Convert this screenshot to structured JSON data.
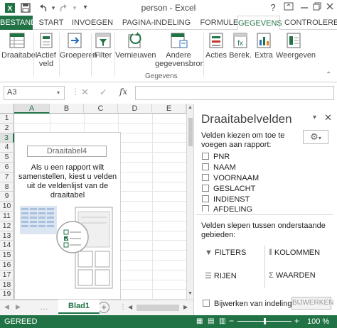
{
  "window": {
    "title": "person - Excel",
    "help_label": "?"
  },
  "tabs": [
    "BESTAND",
    "START",
    "INVOEGEN",
    "PAGINA-INDELING",
    "FORMULES",
    "GEGEVENS",
    "CONTROLERE"
  ],
  "ribbon": {
    "buttons": [
      {
        "label": "Draaitabel",
        "sub": "",
        "icon": "pivottable-icon"
      },
      {
        "label": "Actief",
        "sub": "veld",
        "icon": "active-field-icon"
      },
      {
        "label": "Groeperen",
        "sub": "",
        "icon": "group-icon"
      },
      {
        "label": "Filter",
        "sub": "",
        "icon": "filter-icon"
      },
      {
        "label": "Vernieuwen",
        "sub": "",
        "icon": "refresh-icon"
      },
      {
        "label": "Andere",
        "sub": "gegevensbron",
        "icon": "change-source-icon"
      },
      {
        "label": "Acties",
        "sub": "",
        "icon": "actions-icon"
      },
      {
        "label": "Berek.",
        "sub": "",
        "icon": "calculations-icon"
      },
      {
        "label": "Extra",
        "sub": "",
        "icon": "tools-icon"
      },
      {
        "label": "Weergeven",
        "sub": "",
        "icon": "show-icon"
      }
    ],
    "group_label": "Gegevens"
  },
  "formula_bar": {
    "name_box": "A3",
    "fx": "fx",
    "content": ""
  },
  "grid": {
    "columns": [
      "A",
      "B",
      "C",
      "D",
      "E"
    ],
    "selected_column": "A",
    "rows": [
      "1",
      "2",
      "3",
      "4",
      "5",
      "6",
      "7",
      "8",
      "9",
      "10",
      "11",
      "12",
      "13",
      "14",
      "15",
      "16",
      "17",
      "18",
      "19"
    ],
    "selected_row": "3"
  },
  "pivot_placeholder": {
    "name": "Draaitabel4",
    "instruction": "Als u een rapport wilt samenstellen, kiest u velden uit de veldenlijst van de draaitabel"
  },
  "sheet": {
    "tab": "Blad1"
  },
  "pane": {
    "title": "Draaitabelvelden",
    "choose_label": "Velden kiezen om toe te voegen aan rapport:",
    "fields": [
      "PNR",
      "NAAM",
      "VOORNAAM",
      "GESLACHT",
      "INDIENST",
      "AFDELING"
    ],
    "drag_label": "Velden slepen tussen onderstaande gebieden:",
    "areas": {
      "filters": "FILTERS",
      "columns": "KOLOMMEN",
      "rows": "RIJEN",
      "values": "WAARDEN"
    },
    "defer_label": "Bijwerken van indeling ...",
    "update_button": "BIJWERKEN"
  },
  "status": {
    "ready": "GEREED",
    "zoom": "100 %"
  },
  "colors": {
    "accent": "#217346"
  }
}
